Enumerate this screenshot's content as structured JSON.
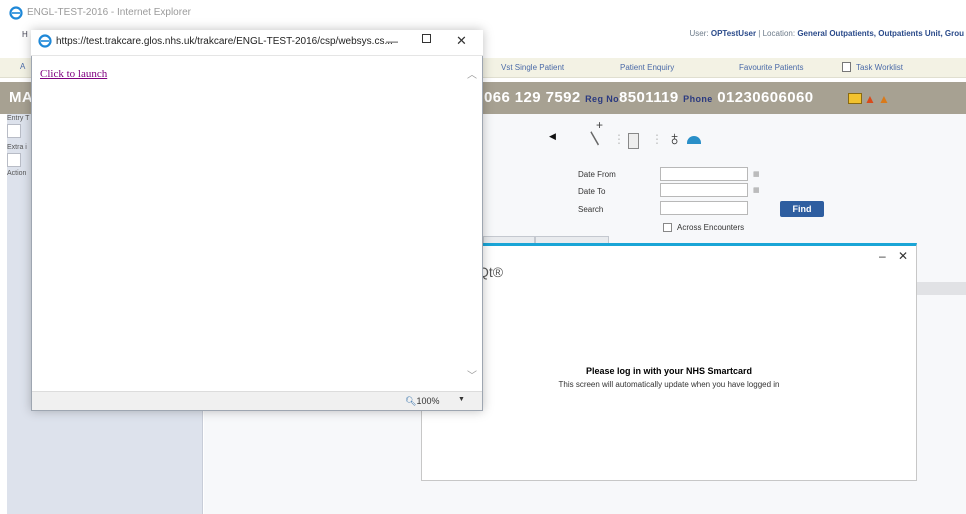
{
  "window": {
    "title": "ENGL-TEST-2016 - Internet Explorer"
  },
  "header": {
    "user_label": "User",
    "user_value": "OPTestUser",
    "location_label": "Location",
    "location_value": "General Outpatients, Outpatients Unit, Grou",
    "home_fragment": "H"
  },
  "menu": {
    "items": [
      "Vst Single Patient",
      "Patient Enquiry",
      "Favourite Patients",
      "Task Worklist"
    ],
    "left_fragment": "A"
  },
  "patient_banner": {
    "name_fragment": "MA",
    "nhs_fragment": "066 129 7592",
    "reg_label": "Reg No",
    "reg_value": "8501119",
    "phone_label": "Phone",
    "phone_value": "01230606060"
  },
  "left_panel": {
    "labels": [
      "Entry T",
      "Extra i",
      "Action"
    ]
  },
  "search_form": {
    "date_from_label": "Date From",
    "date_to_label": "Date To",
    "search_label": "Search",
    "find_label": "Find",
    "across_label": "Across Encounters"
  },
  "smartcard": {
    "logo": "Qt®",
    "heading": "Please log in with your NHS Smartcard",
    "subtext": "This screen will automatically update when you have logged in",
    "minimize": "–",
    "close": "✕"
  },
  "popup": {
    "url": "https://test.trakcare.glos.nhs.uk/trakcare/ENGL-TEST-2016/csp/websys.cs...",
    "link_text": "Click to launch",
    "zoom": "100%",
    "minimize": "—",
    "close": "✕"
  },
  "colors": {
    "accent": "#1aa5d6",
    "banner": "#a7a192",
    "find": "#2e5ea0"
  }
}
